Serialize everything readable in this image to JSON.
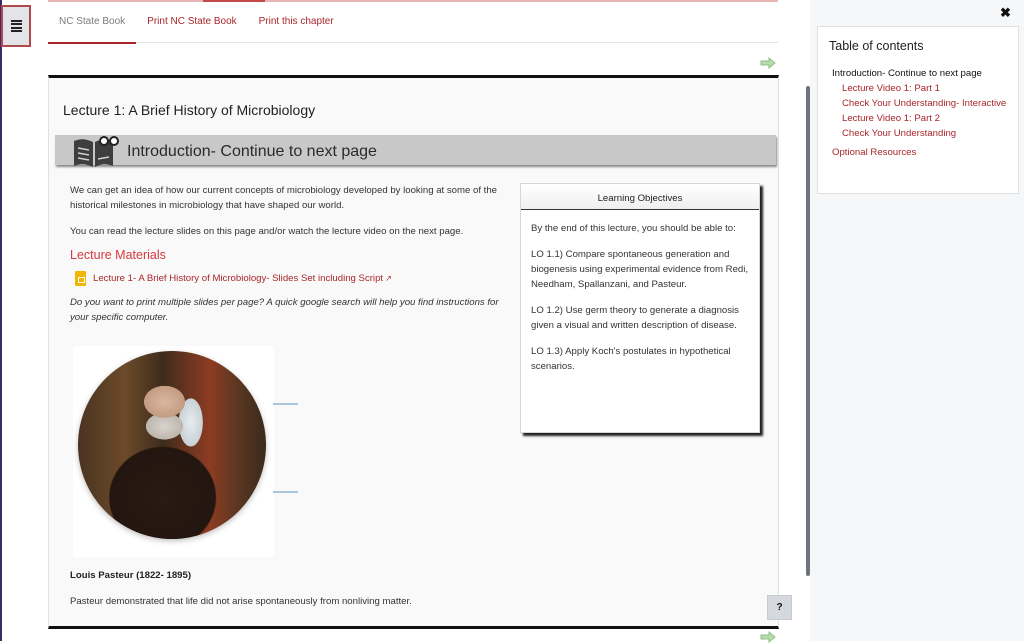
{
  "nav": {
    "tabs": [
      {
        "label": "NC State Book",
        "active": true
      },
      {
        "label": "Print NC State Book",
        "active": false
      },
      {
        "label": "Print this chapter",
        "active": false
      }
    ],
    "toc_toggle_icon": "list-icon",
    "next_icon": "next-page-arrow-icon"
  },
  "lecture": {
    "title": "Lecture 1: A Brief History of Microbiology",
    "section_title": "Introduction- Continue to next page",
    "section_icon": "book-reading-icon",
    "intro_paragraph": "We can get an idea of how our current concepts of microbiology developed by looking at some of the historical milestones in microbiology that have shaped our world.",
    "slides_paragraph": "You can read the lecture slides on this page and/or watch the lecture video on the next page.",
    "materials_heading": "Lecture Materials",
    "slides_link": "Lecture 1- A Brief History of Microbiology- Slides Set including Script",
    "print_note": "Do you want to print multiple slides per page? A quick google search will help you find instructions for your specific computer.",
    "portrait_alt": "Portrait of Louis Pasteur",
    "caption_title": "Louis Pasteur (1822- 1895)",
    "caption_text": "Pasteur demonstrated that life did not arise spontaneously from nonliving matter."
  },
  "objectives": {
    "heading": "Learning Objectives",
    "intro": "By the end of this lecture, you should be able to:",
    "items": [
      "LO 1.1) Compare spontaneous generation and biogenesis using experimental evidence from Redi, Needham, Spallanzani, and Pasteur.",
      "LO 1.2) Use germ theory to generate a diagnosis given a visual and written description of disease.",
      "LO 1.3) Apply Koch's postulates in hypothetical scenarios."
    ]
  },
  "help": {
    "label": "?"
  },
  "toc": {
    "close_label": "✖",
    "title": "Table of contents",
    "current": "Introduction- Continue to next page",
    "sub_items": [
      "Lecture Video 1: Part 1",
      "Check Your Understanding- Interactive",
      "Lecture Video 1: Part 2",
      "Check Your Understanding"
    ],
    "other_items": [
      "Optional Resources"
    ]
  },
  "colors": {
    "link": "#a8262b",
    "heading_red": "#d43a3e",
    "section_bar": "#c8c8c8",
    "next_arrow": "#a6d19a"
  }
}
